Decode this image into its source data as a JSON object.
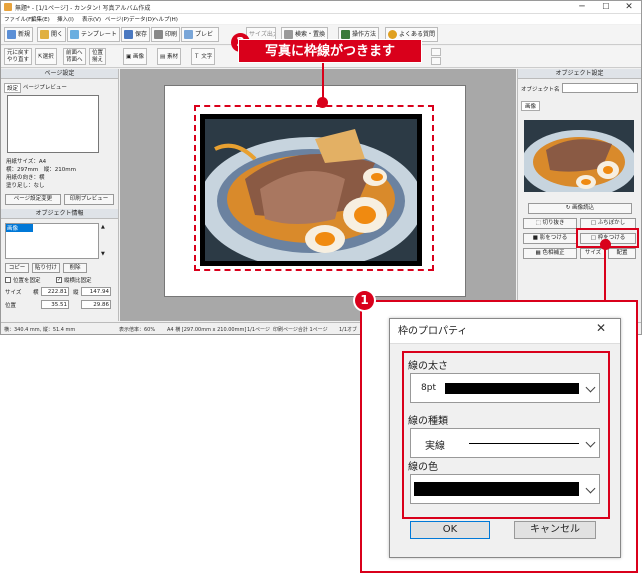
{
  "window": {
    "title": "無題* - [1/1ページ] - カンタン! 写真アルバム作成",
    "minimize": "─",
    "maximize": "☐",
    "close": "✕"
  },
  "menu": [
    "ファイル(F)",
    "編集(E)",
    "挿入(I)",
    "表示(V)",
    "ページ(P)",
    "データ(D)",
    "ヘルプ(H)"
  ],
  "toolbar": {
    "new": "新規",
    "open": "開く",
    "template": "テンプレート",
    "save": "保存",
    "print": "印刷",
    "preview": "プレビ",
    "print2": "サイズ出力",
    "search": "検索・置換",
    "howto": "操作方法",
    "faq": "よくある質問"
  },
  "toolbar2": {
    "undo": "元に戻す",
    "redo": "やり直す",
    "select": "選択",
    "front": "前面へ",
    "back": "背面へ",
    "align": "位置",
    "align2": "揃え",
    "image": "画像",
    "material": "素材",
    "text": "文字"
  },
  "left": {
    "page_settings": "ページ設定",
    "tab_settings": "設定",
    "tab_preview": "ページプレビュー",
    "paper_size": "用紙サイズ：A4",
    "dims": "横：297mm　縦：210mm",
    "orientation": "用紙の向き：横",
    "bleed": "塗り足し：なし",
    "change_btn": "ページ設定変更",
    "print_preview_btn": "印刷プレビュー",
    "obj_info": "オブジェクト情報",
    "obj_item": "画像",
    "copy": "コピー",
    "paste": "貼り付け",
    "delete": "削除",
    "pos_fixed": "位置を固定",
    "ratio_fixed": "縦横比固定",
    "size": "サイズ",
    "w_label": "横",
    "h_label": "縦",
    "pos": "位置",
    "w": "222.81",
    "h": "147.94",
    "x": "35.51",
    "y": "29.86"
  },
  "right": {
    "obj_settings": "オブジェクト設定",
    "obj_name": "オブジェクト名",
    "tab_image": "画像",
    "load_image": "画像読込",
    "crop": "切り抜き",
    "blur": "ふちぼかし",
    "shadow": "影をつける",
    "frame": "枠をつける",
    "color": "色相補正",
    "size": "サイズ",
    "position": "配置"
  },
  "status": {
    "coord": "横：340.4 mm, 縦：51.4 mm",
    "zoom": "表示倍率：60%",
    "paper": "A4 横 [297.00mm x 210.00mm]",
    "page": "1/1ページ",
    "print_total": "印刷ページ合計 1ページ",
    "right": "1/1オブ"
  },
  "callouts": {
    "n1": "1",
    "n2": "2",
    "banner": "写真に枠線がつきます"
  },
  "dialog": {
    "title": "枠のプロパティ",
    "close": "✕",
    "width_label": "線の太さ",
    "width_value": "8pt",
    "type_label": "線の種類",
    "type_value": "実線",
    "color_label": "線の色",
    "ok": "OK",
    "cancel": "キャンセル"
  },
  "colors": {
    "accent": "#d9001b",
    "selection": "#0078d7",
    "frame_color": "#000000"
  }
}
